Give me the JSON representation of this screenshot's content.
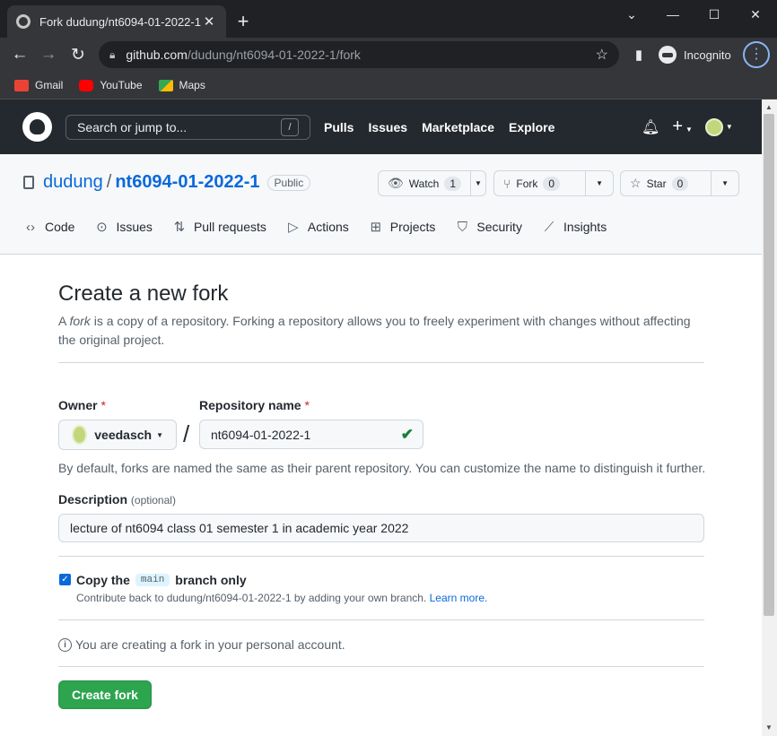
{
  "browser": {
    "tab_title": "Fork dudung/nt6094-01-2022-1",
    "url_host": "github.com",
    "url_path": "/dudung/nt6094-01-2022-1/fork",
    "profile_label": "Incognito",
    "bookmarks": [
      {
        "label": "Gmail",
        "color": "#ea4335"
      },
      {
        "label": "YouTube",
        "color": "#ff0000"
      },
      {
        "label": "Maps",
        "color": "#34a853"
      }
    ]
  },
  "gh_header": {
    "search_placeholder": "Search or jump to...",
    "search_shortcut": "/",
    "nav": [
      "Pulls",
      "Issues",
      "Marketplace",
      "Explore"
    ]
  },
  "repo": {
    "owner": "dudung",
    "separator": "/",
    "name": "nt6094-01-2022-1",
    "visibility": "Public",
    "watch": {
      "label": "Watch",
      "count": "1"
    },
    "fork": {
      "label": "Fork",
      "count": "0"
    },
    "star": {
      "label": "Star",
      "count": "0"
    },
    "tabs": [
      "Code",
      "Issues",
      "Pull requests",
      "Actions",
      "Projects",
      "Security",
      "Insights"
    ]
  },
  "form": {
    "heading": "Create a new fork",
    "lead_prefix": "A ",
    "lead_em": "fork",
    "lead_rest": " is a copy of a repository. Forking a repository allows you to freely experiment with changes without affecting the original project.",
    "owner_label": "Owner",
    "required_mark": "*",
    "owner_value": "veedasch",
    "slash": "/",
    "repo_name_label": "Repository name",
    "repo_name_value": "nt6094-01-2022-1",
    "name_note": "By default, forks are named the same as their parent repository. You can customize the name to distinguish it further.",
    "description_label": "Description",
    "description_optional": "(optional)",
    "description_value": "lecture of nt6094 class 01 semester 1 in academic year 2022",
    "copy_prefix": "Copy the",
    "copy_branch": "main",
    "copy_suffix": "branch only",
    "copy_checked": true,
    "contribute_text": "Contribute back to dudung/nt6094-01-2022-1 by adding your own branch.",
    "learn_more": "Learn more.",
    "personal_note": "You are creating a fork in your personal account.",
    "create_button": "Create fork"
  }
}
